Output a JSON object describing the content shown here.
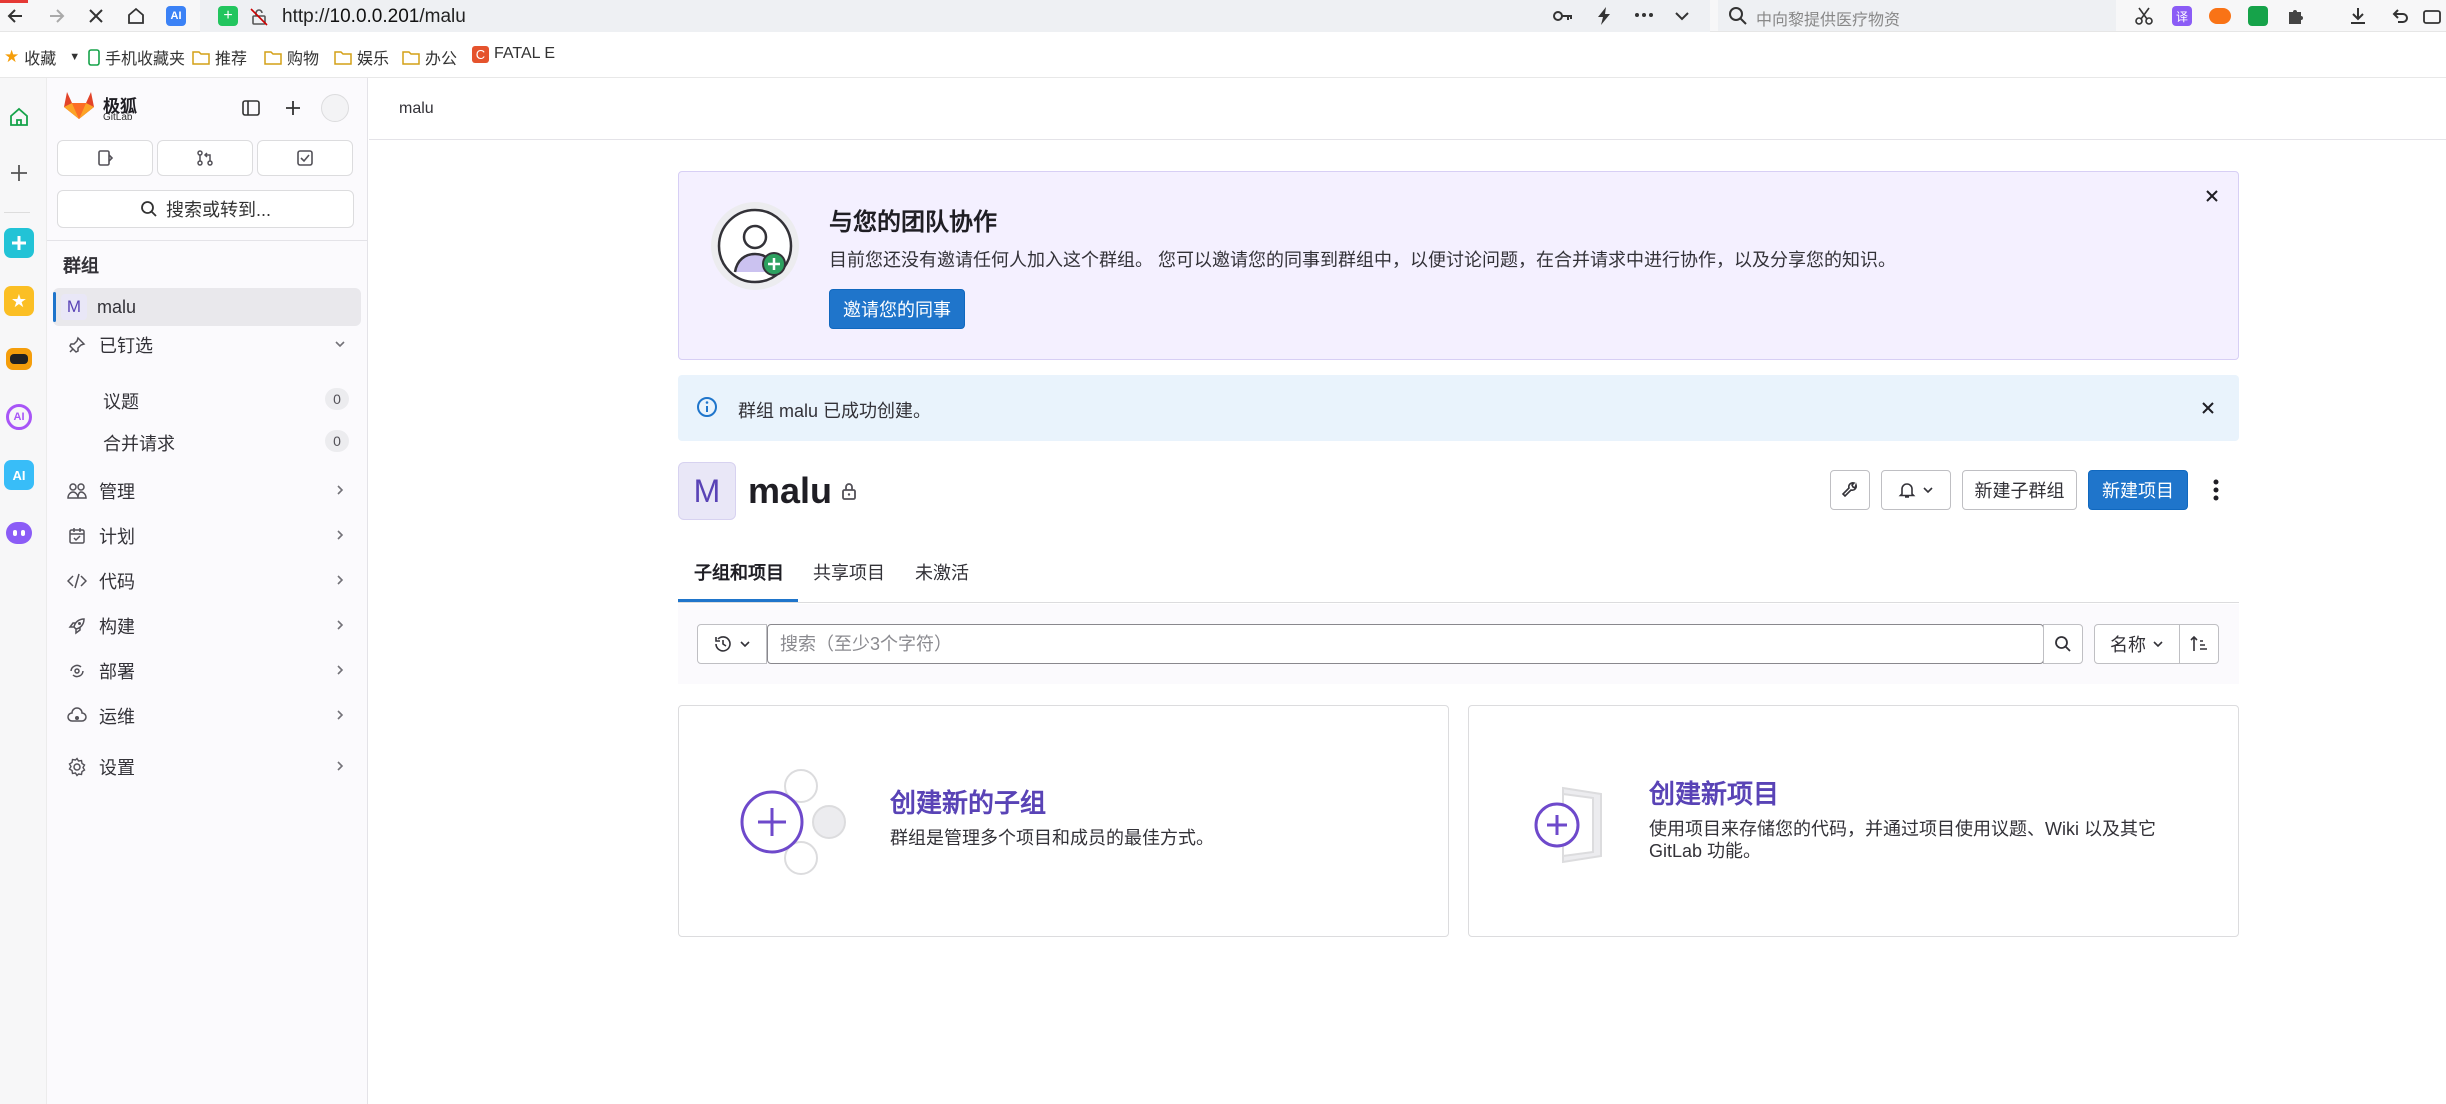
{
  "browser": {
    "url_scheme": "http://",
    "url_host": "10.0.0.201",
    "url_path": "/malu",
    "search_placeholder": "中向黎提供医疗物资"
  },
  "bookmarks": [
    "收藏",
    "手机收藏夹",
    "推荐",
    "购物",
    "娱乐",
    "办公",
    "FATAL E"
  ],
  "sidebar": {
    "brand": "极狐",
    "brand_sub": "GitLab",
    "search_label": "搜索或转到...",
    "section_heading": "群组",
    "group_avatar_letter": "M",
    "group_name": "malu",
    "pinned_label": "已钉选",
    "pinned_items": [
      {
        "label": "议题",
        "count": "0"
      },
      {
        "label": "合并请求",
        "count": "0"
      }
    ],
    "nav": [
      "管理",
      "计划",
      "代码",
      "构建",
      "部署",
      "运维",
      "设置"
    ]
  },
  "breadcrumb": "malu",
  "invite_banner": {
    "title": "与您的团队协作",
    "description": "目前您还没有邀请任何人加入这个群组。 您可以邀请您的同事到群组中，以便讨论问题，在合并请求中进行协作，以及分享您的知识。",
    "button": "邀请您的同事"
  },
  "alert": {
    "text": "群组 malu 已成功创建。"
  },
  "group": {
    "avatar_letter": "M",
    "name": "malu",
    "new_subgroup_button": "新建子群组",
    "new_project_button": "新建项目"
  },
  "tabs": [
    "子组和项目",
    "共享项目",
    "未激活"
  ],
  "filter": {
    "placeholder": "搜索（至少3个字符）",
    "sort_label": "名称"
  },
  "cards": {
    "subgroup": {
      "title": "创建新的子组",
      "description": "群组是管理多个项目和成员的最佳方式。"
    },
    "project": {
      "title": "创建新项目",
      "description_line1": "使用项目来存储您的代码，并通过项目使用议题、Wiki 以及其它",
      "description_line2": "GitLab 功能。"
    }
  },
  "colors": {
    "primary_blue": "#1f75cb",
    "purple_accent": "#5943b6",
    "invite_bg": "#f4f0ff",
    "alert_bg": "#e9f3fc"
  }
}
